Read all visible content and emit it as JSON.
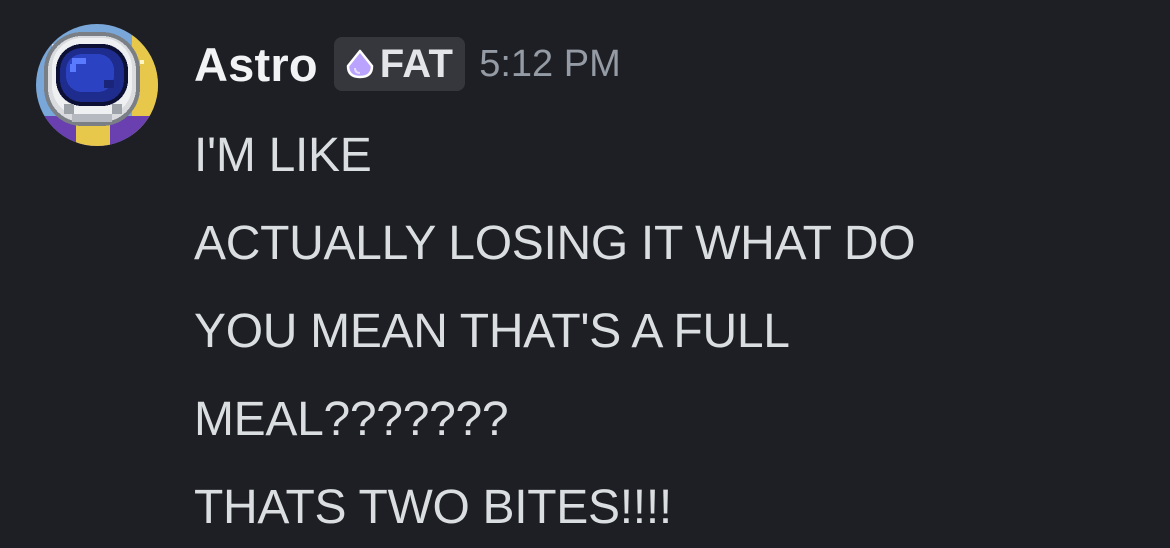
{
  "message": {
    "author": {
      "name": "Astro",
      "avatar_icon": "pixel-astronaut-helmet-icon",
      "tag": {
        "icon": "purple-gem-icon",
        "label": "FAT"
      }
    },
    "timestamp": "5:12 PM",
    "lines": [
      "I'M LIKE",
      "ACTUALLY LOSING IT WHAT DO",
      "YOU MEAN THAT'S A FULL",
      "MEAL???????",
      "THATS TWO BITES!!!!"
    ]
  },
  "colors": {
    "background": "#1e1f24",
    "username": "#f2f3f5",
    "text": "#dbdee1",
    "timestamp": "#949ba4",
    "tag_background": "#35373c",
    "gem": "#b9a3ff"
  }
}
